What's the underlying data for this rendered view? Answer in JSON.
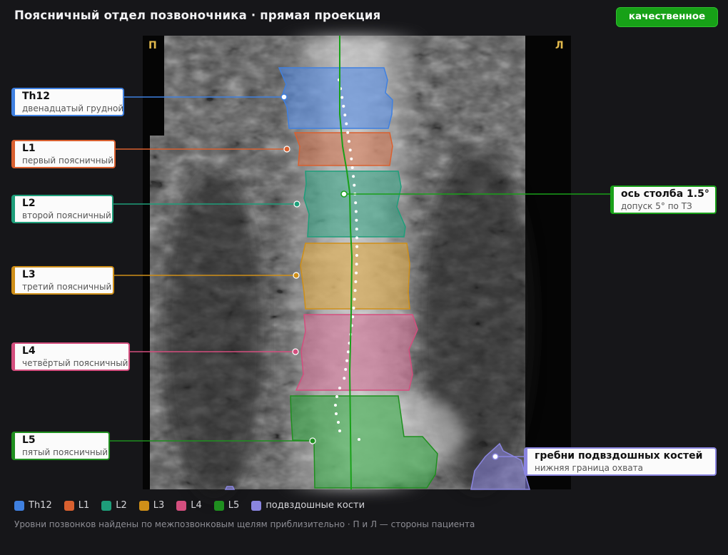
{
  "header": {
    "title": "Поясничный отдел позвоночника · прямая проекция",
    "badge": "качественное"
  },
  "orientation": {
    "right": "П",
    "left": "Л"
  },
  "colors": {
    "Th12": "#3f80e0",
    "L1": "#d9602f",
    "L2": "#1e9e7a",
    "L3": "#cf8f18",
    "L4": "#d44e7e",
    "L5": "#1f8f1f",
    "ilium": "#8a85e0",
    "axis": "#19a019"
  },
  "vertebrae": [
    {
      "key": "Th12",
      "name": "Th12",
      "sub": "двенадцатый грудной"
    },
    {
      "key": "L1",
      "name": "L1",
      "sub": "первый поясничный"
    },
    {
      "key": "L2",
      "name": "L2",
      "sub": "второй поясничный"
    },
    {
      "key": "L3",
      "name": "L3",
      "sub": "третий поясничный"
    },
    {
      "key": "L4",
      "name": "L4",
      "sub": "четвёртый поясничный"
    },
    {
      "key": "L5",
      "name": "L5",
      "sub": "пятый поясничный"
    }
  ],
  "axis": {
    "title": "ось столба 1.5°",
    "sub": "допуск 5° по ТЗ"
  },
  "ilium": {
    "title": "гребни подвздошных костей",
    "sub": "нижняя граница охвата"
  },
  "legend": [
    {
      "key": "Th12",
      "label": "Th12"
    },
    {
      "key": "L1",
      "label": "L1"
    },
    {
      "key": "L2",
      "label": "L2"
    },
    {
      "key": "L3",
      "label": "L3"
    },
    {
      "key": "L4",
      "label": "L4"
    },
    {
      "key": "L5",
      "label": "L5"
    },
    {
      "key": "ilium",
      "label": "подвздошные кости"
    }
  ],
  "footnote": "Уровни позвонков найдены по межпозвонковым щелям приблизительно · П и Л — стороны пациента"
}
